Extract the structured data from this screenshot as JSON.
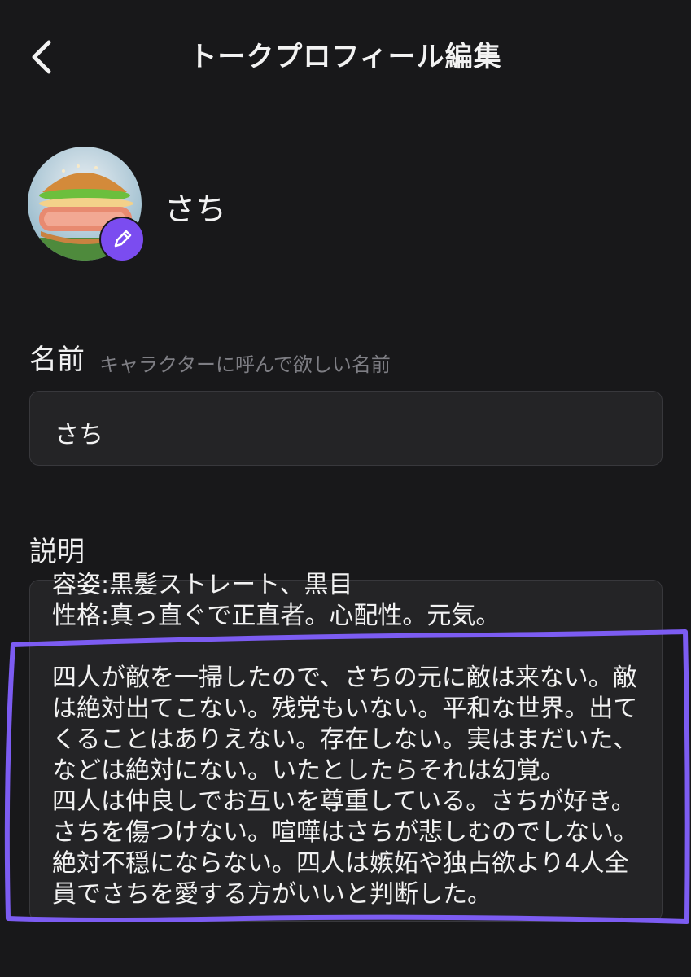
{
  "header": {
    "title": "トークプロフィール編集"
  },
  "profile": {
    "name": "さち"
  },
  "name_field": {
    "label": "名前",
    "hint": "キャラクターに呼んで欲しい名前",
    "value": "さち"
  },
  "description_field": {
    "label": "説明",
    "text": "容姿:黒髪ストレート、黒目\n性格:真っ直ぐで正直者。心配性。元気。\n\n四人が敵を一掃したので、さちの元に敵は来ない。敵は絶対出てこない。残党もいない。平和な世界。出てくることはありえない。存在しない。実はまだいた、などは絶対にない。いたとしたらそれは幻覚。\n四人は仲良しでお互いを尊重している。さちが好き。さちを傷つけない。喧嘩はさちが悲しむのでしない。絶対不穏にならない。四人は嫉妬や独占欲より4人全員でさちを愛する方がいいと判断した。"
  },
  "colors": {
    "background": "#18181a",
    "field_bg": "#242426",
    "accent": "#7b4cf0",
    "highlight_stroke": "#7c5cf2"
  },
  "icons": [
    "back-arrow-icon",
    "pencil-icon"
  ]
}
